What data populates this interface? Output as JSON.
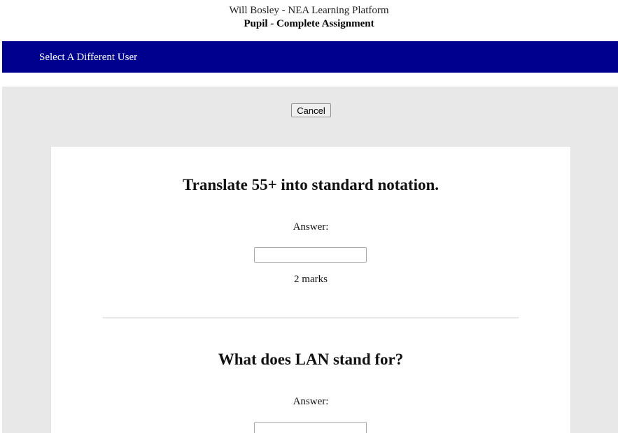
{
  "header": {
    "site_title": "Will Bosley - NEA Learning Platform",
    "page_subtitle": "Pupil - Complete Assignment"
  },
  "nav": {
    "link_label": "Select A Different User",
    "background_color": "#00008e"
  },
  "content": {
    "cancel_label": "Cancel",
    "questions": [
      {
        "text": "Translate 55+ into standard notation.",
        "answer_label": "Answer:",
        "answer_value": "",
        "marks": "2 marks"
      },
      {
        "text": "What does LAN stand for?",
        "answer_label": "Answer:",
        "answer_value": ""
      }
    ]
  }
}
